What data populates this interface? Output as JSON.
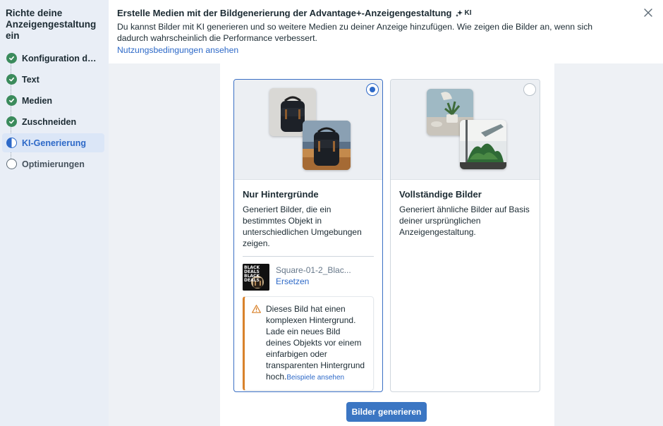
{
  "sidebar": {
    "title": "Richte deine Anzeigengestaltung ein",
    "steps": [
      {
        "label": "Konfiguration der Werbeanzeige",
        "state": "done"
      },
      {
        "label": "Text",
        "state": "done"
      },
      {
        "label": "Medien",
        "state": "done"
      },
      {
        "label": "Zuschneiden",
        "state": "done"
      },
      {
        "label": "KI-Generierung",
        "state": "active"
      },
      {
        "label": "Optimierungen",
        "state": "todo"
      }
    ]
  },
  "header": {
    "title": "Erstelle Medien mit der Bildgenerierung der Advantage+-Anzeigengestaltung",
    "ai_badge": "KI",
    "description": "Du kannst Bilder mit KI generieren und so weitere Medien zu deiner Anzeige hinzufügen. Wie zeigen die Bilder an, wenn sich dadurch wahrscheinlich die Performance verbessert.",
    "link": "Nutzungsbedingungen ansehen"
  },
  "options": [
    {
      "title": "Nur Hintergründe",
      "description": "Generiert Bilder, die ein bestimmtes Objekt in unterschiedlichen Umgebungen zeigen.",
      "selected": true,
      "file": {
        "name": "Square-01-2_Blac...",
        "thumb_text": "BLACK DEALS\nBLACK DEALS",
        "replace_label": "Ersetzen"
      },
      "warning": {
        "text": "Dieses Bild hat einen komplexen Hintergrund. Lade ein neues Bild deines Objekts vor einem einfarbigen oder transparenten Hintergrund hoch.",
        "link": "Beispiele ansehen"
      }
    },
    {
      "title": "Vollständige Bilder",
      "description": "Generiert ähnliche Bilder auf Basis deiner ursprünglichen Anzeigengestaltung.",
      "selected": false
    }
  ],
  "generate_button": "Bilder generieren",
  "colors": {
    "accent": "#2d69c8",
    "success": "#3b8b5c",
    "warning": "#d9822b",
    "sidebar_bg": "#e9eef6"
  }
}
